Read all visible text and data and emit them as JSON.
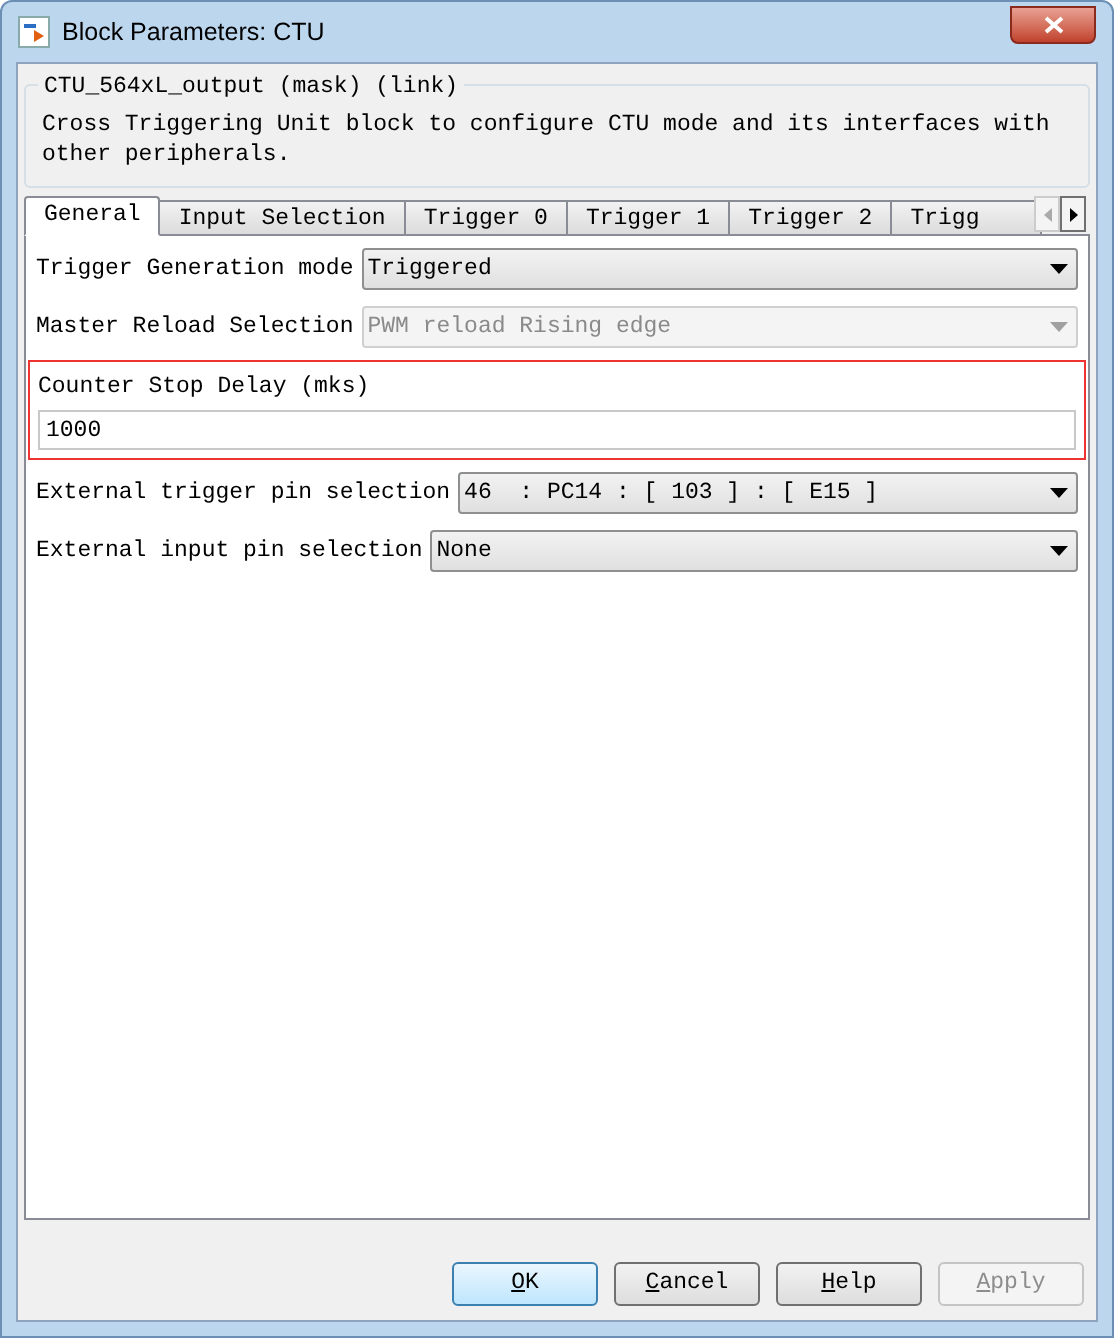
{
  "window": {
    "title": "Block Parameters: CTU"
  },
  "mask": {
    "title": "CTU_564xL_output (mask) (link)",
    "description": "Cross Triggering Unit block to configure CTU mode and its interfaces with other peripherals."
  },
  "tabs": [
    {
      "label": "General",
      "selected": true
    },
    {
      "label": "Input Selection",
      "selected": false
    },
    {
      "label": "Trigger 0",
      "selected": false
    },
    {
      "label": "Trigger 1",
      "selected": false
    },
    {
      "label": "Trigger 2",
      "selected": false
    },
    {
      "label": "Trigg",
      "selected": false
    }
  ],
  "parameters": [
    {
      "kind": "dropdown",
      "label": "Trigger Generation mode",
      "value": "Triggered",
      "disabled": false
    },
    {
      "kind": "dropdown",
      "label": "Master Reload Selection",
      "value": "PWM reload Rising edge",
      "disabled": true
    },
    {
      "kind": "edit",
      "label": "Counter Stop Delay (mks)",
      "value": "1000",
      "highlighted": true
    },
    {
      "kind": "dropdown",
      "label": "External trigger pin selection",
      "value": "46  : PC14 : [ 103 ] : [ E15 ]",
      "disabled": false
    },
    {
      "kind": "dropdown",
      "label": "External input pin selection",
      "value": "None",
      "disabled": false
    }
  ],
  "buttons": [
    {
      "label": "OK",
      "default": true,
      "disabled": false
    },
    {
      "label": "Cancel",
      "default": false,
      "disabled": false
    },
    {
      "label": "Help",
      "default": false,
      "disabled": false
    },
    {
      "label": "Apply",
      "default": false,
      "disabled": true
    }
  ]
}
